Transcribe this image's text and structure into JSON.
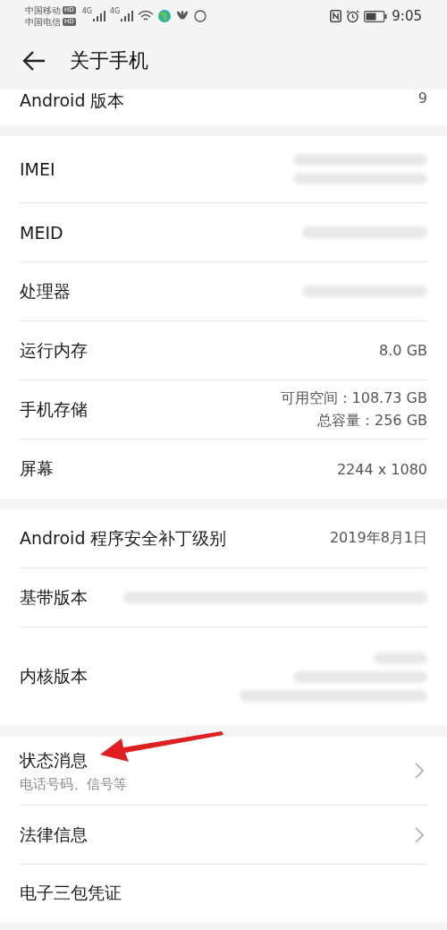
{
  "status_bar": {
    "carriers": [
      {
        "name": "中国移动",
        "badge": "HD"
      },
      {
        "name": "中国电信",
        "badge": "HD"
      }
    ],
    "signals": [
      {
        "network": "4G"
      },
      {
        "network": "4G"
      }
    ],
    "time": "9:05"
  },
  "header": {
    "title": "关于手机"
  },
  "sections": [
    {
      "rows": [
        {
          "kind": "value",
          "label": "Android 版本",
          "lines": [
            "9"
          ],
          "cut": true
        }
      ]
    },
    {
      "rows": [
        {
          "kind": "blurredpair",
          "label": "IMEI"
        },
        {
          "kind": "blurred",
          "label": "MEID"
        },
        {
          "kind": "blurred",
          "label": "处理器"
        },
        {
          "kind": "value",
          "label": "运行内存",
          "lines": [
            "8.0 GB"
          ]
        },
        {
          "kind": "value",
          "label": "手机存储",
          "lines": [
            "可用空间：108.73  GB",
            "总容量：256  GB"
          ]
        },
        {
          "kind": "value",
          "label": "屏幕",
          "lines": [
            "2244 x 1080"
          ]
        }
      ]
    },
    {
      "rows": [
        {
          "kind": "value",
          "label": "Android 程序安全补丁级别",
          "lines": [
            "2019年8月1日"
          ]
        },
        {
          "kind": "blurredlong",
          "label": "基带版本"
        },
        {
          "kind": "blurredblock",
          "label": "内核版本"
        }
      ]
    },
    {
      "rows": [
        {
          "kind": "link",
          "label": "状态消息",
          "subtitle": "电话号码、信号等",
          "arrow": true
        },
        {
          "kind": "link",
          "label": "法律信息"
        },
        {
          "kind": "link",
          "label": "电子三包凭证",
          "chevron": false
        }
      ]
    }
  ]
}
